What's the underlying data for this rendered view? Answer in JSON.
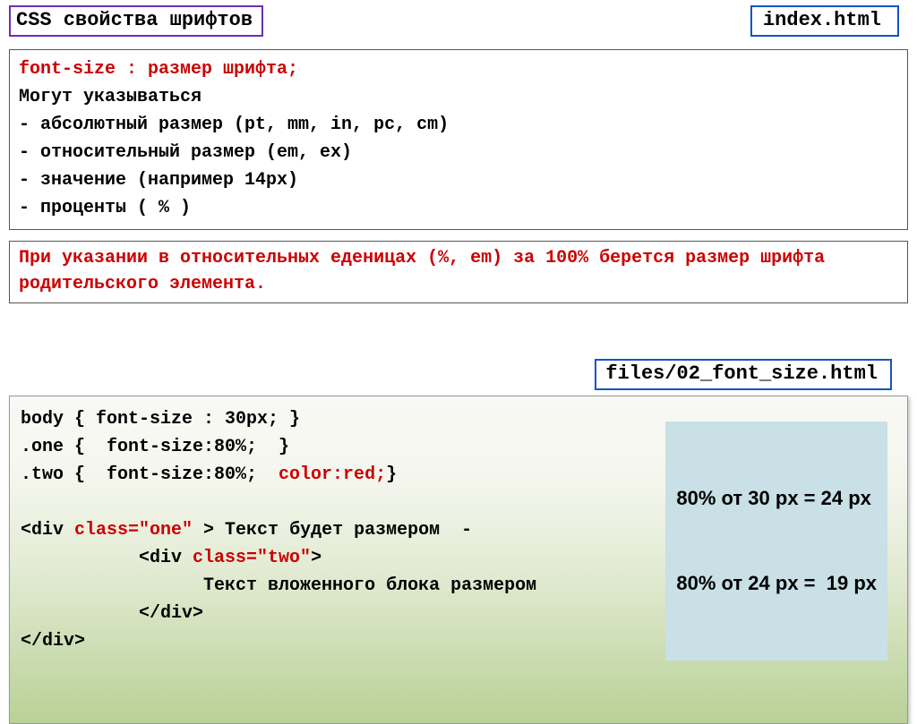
{
  "title": "CSS свойства шрифтов",
  "filename1": "index.html",
  "syntax": {
    "prop_line": "font-size : размер  шрифта;",
    "subhead": " Могут указываться",
    "item1": " -   абсолютный размер (pt, mm, in, pc, cm)",
    "item2": " -   относительный размер  (em, ex)",
    "item3": " -   значение (например  14px)",
    "item4": " -   проценты ( % )"
  },
  "note": "При указании в относительных еденицах (%, em) за 100% берется размер шрифта родительского элемента.",
  "filename2": "files/02_font_size.html",
  "code": {
    "l1": "body { font-size : 30px; }",
    "l2": ".one {  font-size:80%;  }",
    "l3_a": ".two {  font-size:80%;  ",
    "l3_b": "color:red;",
    "l3_c": "}",
    "blank": " ",
    "l4_a": "<div ",
    "l4_b": "class=\"one\" ",
    "l4_c": "> Текст будет размером  -",
    "l5_a": "           <div ",
    "l5_b": "class=\"two\"",
    "l5_c": ">",
    "l6": "                 Текст вложенного блока размером",
    "l7": "           </div>",
    "l8": "</div>"
  },
  "calc": {
    "line1": "80% от 30 px = 24 px",
    "line2": "80% от 24 px =  19 px"
  }
}
